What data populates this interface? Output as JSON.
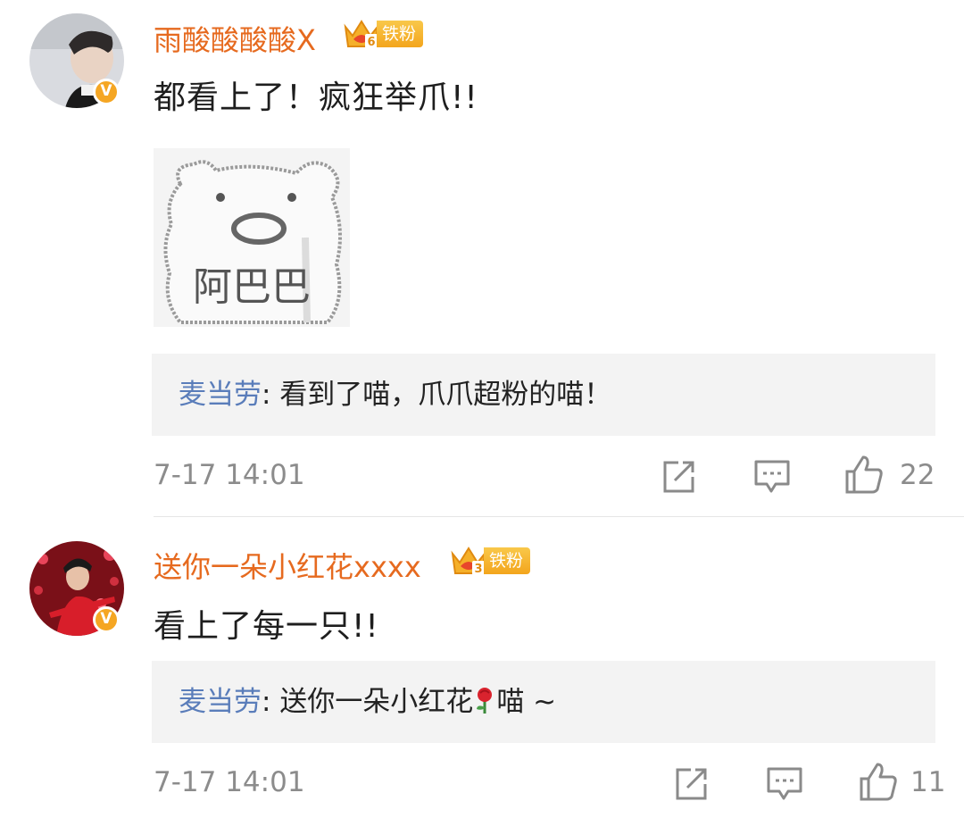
{
  "comments": [
    {
      "username": "雨酸酸酸酸X",
      "badge": "铁粉",
      "badge_level": "6",
      "text": "都看上了！疯狂举爪!!",
      "sticker_text": "阿巴巴",
      "reply": {
        "author": "麦当劳",
        "separator": ": ",
        "text": "看到了喵，爪爪超粉的喵！"
      },
      "timestamp": "7-17 14:01",
      "likes": "22"
    },
    {
      "username": "送你一朵小红花xxxx",
      "badge": "铁粉",
      "badge_level": "3",
      "text": "看上了每一只!!",
      "reply": {
        "author": "麦当劳",
        "separator": ": ",
        "text_before": "送你一朵小红花",
        "text_after": "喵 ~"
      },
      "timestamp": "7-17 14:01",
      "likes": "11"
    }
  ],
  "icons": [
    "verified-badge-icon",
    "crown-icon",
    "share-icon",
    "comment-icon",
    "like-icon",
    "rose-emoji-icon"
  ],
  "colors": {
    "username": "#e66a1f",
    "reply_author": "#5a7dba",
    "meta": "#8c8c8c",
    "badge": "#f3a51d",
    "reply_bg": "#f3f3f3"
  }
}
